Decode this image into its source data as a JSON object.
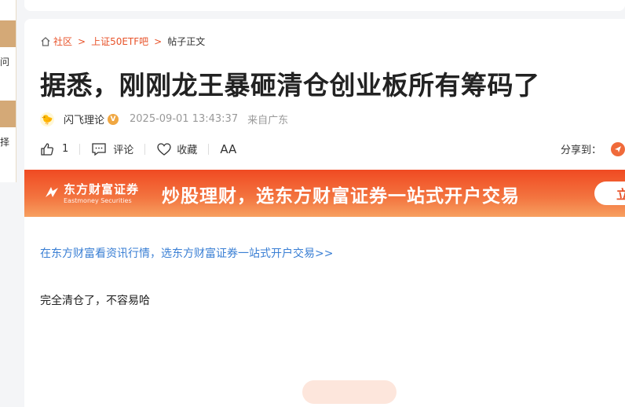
{
  "left_panel": {
    "text1": "问",
    "text2": "择"
  },
  "breadcrumb": {
    "home": "社区",
    "forum": "上证50ETF吧",
    "current": "帖子正文"
  },
  "post": {
    "title": "据悉，刚刚龙王暴砸清仓创业板所有筹码了",
    "author": "闪飞理论",
    "verified_badge": "V",
    "datetime": "2025-09-01 13:43:37",
    "location": "来自广东",
    "content": "完全清仓了，不容易哈"
  },
  "actions": {
    "like_count": "1",
    "comment_label": "评论",
    "favorite_label": "收藏",
    "font_label": "AA",
    "share_label": "分享到："
  },
  "banner": {
    "brand_cn": "东方财富证券",
    "brand_en": "Eastmoney Securities",
    "slogan": "炒股理财，选东方财富证券一站式开户交易",
    "cta_label": "立"
  },
  "promo_link": "在东方财富看资讯行情，选东方财富证券一站式开户交易>>",
  "colors": {
    "accent": "#e8532a",
    "link": "#3a7fd4",
    "banner_top": "#f04a22"
  }
}
